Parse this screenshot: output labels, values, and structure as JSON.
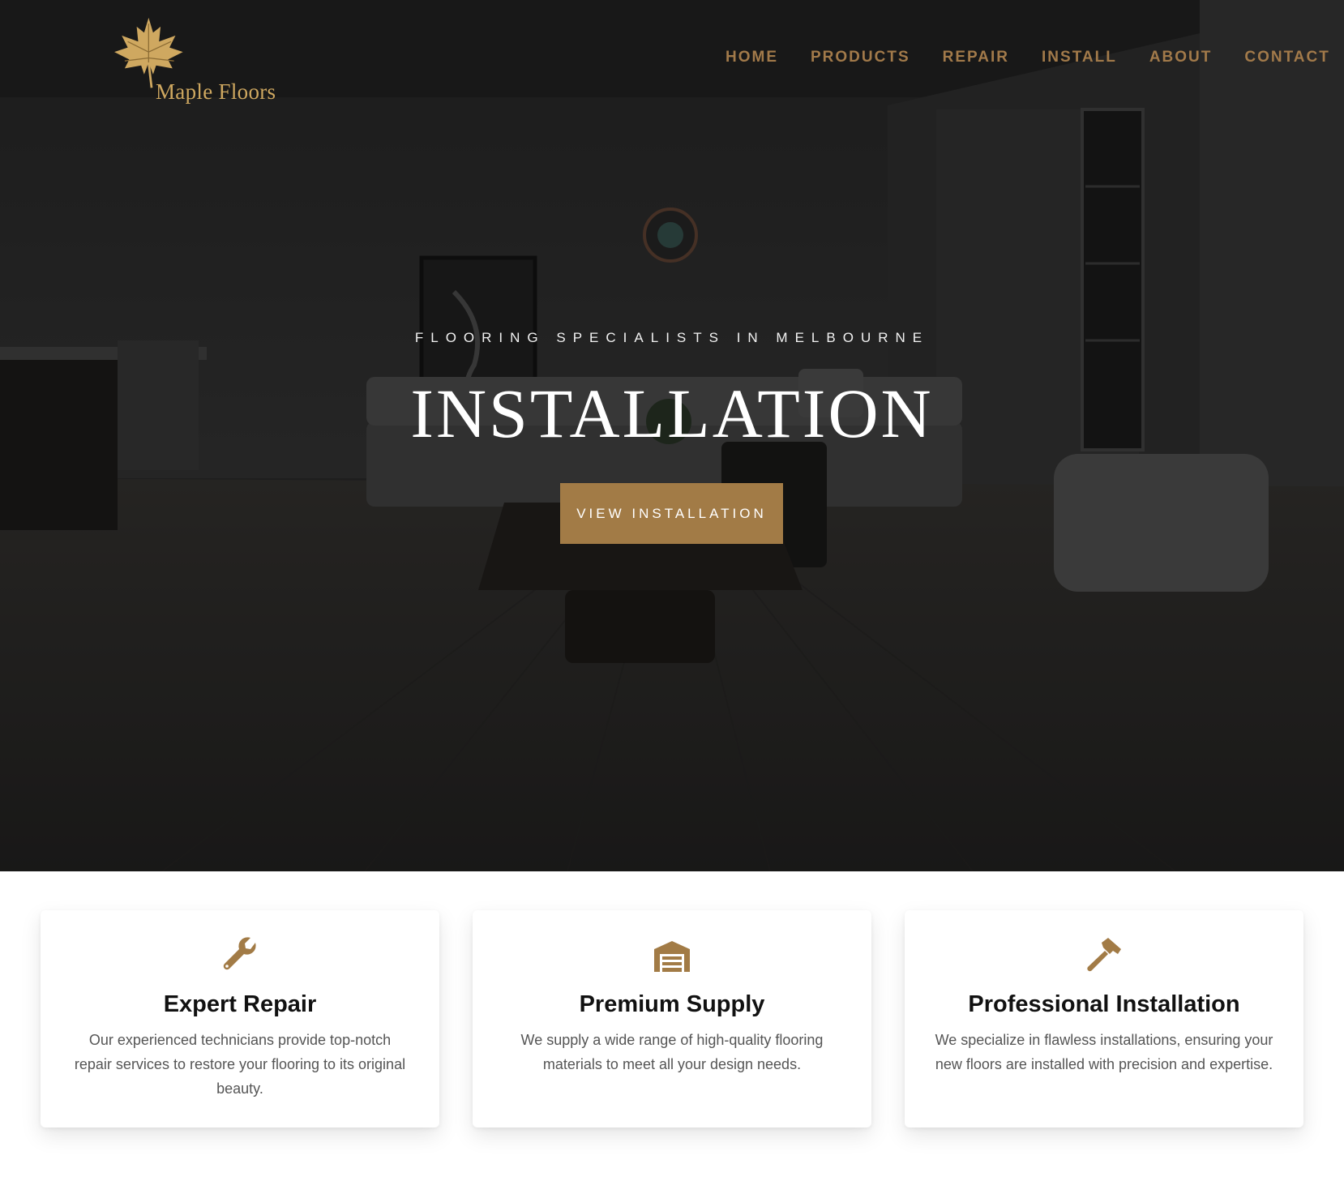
{
  "brand": {
    "name": "Maple Floors",
    "logo_icon": "maple-leaf-icon",
    "accent_color": "#a27b46",
    "logo_color": "#cfa860"
  },
  "nav": {
    "items": [
      {
        "label": "HOME"
      },
      {
        "label": "PRODUCTS"
      },
      {
        "label": "REPAIR"
      },
      {
        "label": "INSTALL"
      },
      {
        "label": "ABOUT"
      },
      {
        "label": "CONTACT"
      }
    ]
  },
  "hero": {
    "kicker": "FLOORING SPECIALISTS IN MELBOURNE",
    "title": "INSTALLATION",
    "button_label": "VIEW INSTALLATION"
  },
  "features": [
    {
      "icon": "wrench-icon",
      "title": "Expert Repair",
      "text": "Our experienced technicians provide top-notch repair services to restore your flooring to its original beauty."
    },
    {
      "icon": "warehouse-icon",
      "title": "Premium Supply",
      "text": "We supply a wide range of high-quality flooring materials to meet all your design needs."
    },
    {
      "icon": "hammer-icon",
      "title": "Professional Installation",
      "text": "We specialize in flawless installations, ensuring your new floors are installed with precision and expertise."
    }
  ]
}
